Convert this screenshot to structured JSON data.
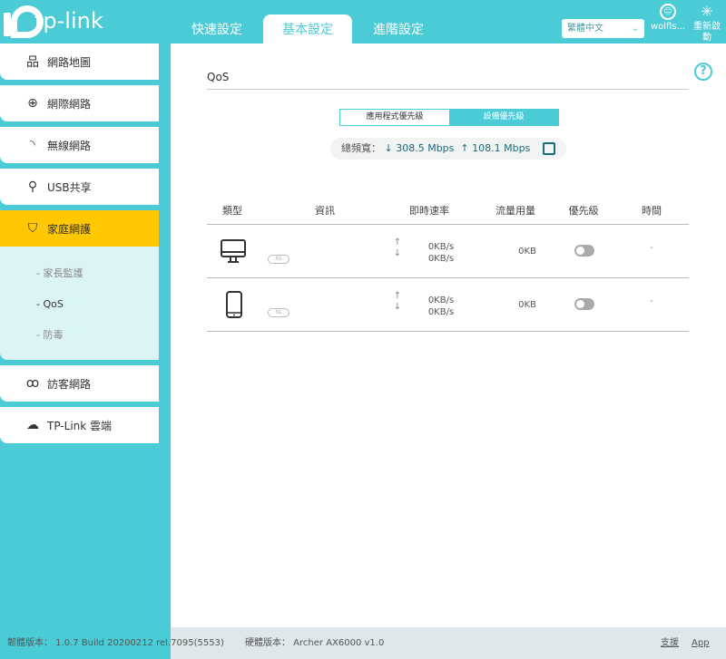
{
  "header": {
    "brand": "tp-link",
    "tabs": [
      "快速設定",
      "基本設定",
      "進階設定"
    ],
    "active_tab": 1,
    "language": "繁體中文",
    "user": "wolfls...",
    "reboot": "重新啟動"
  },
  "sidebar": {
    "items": [
      {
        "label": "網路地圖",
        "icon": "network-map-icon"
      },
      {
        "label": "網際網路",
        "icon": "globe-icon"
      },
      {
        "label": "無線網路",
        "icon": "wireless-icon"
      },
      {
        "label": "USB共享",
        "icon": "usb-icon"
      },
      {
        "label": "家庭網護",
        "icon": "shield-icon"
      },
      {
        "label": "訪客網路",
        "icon": "guests-icon"
      },
      {
        "label": "TP-Link 雲端",
        "icon": "cloud-icon"
      }
    ],
    "subitems": [
      "家長監護",
      "QoS",
      "防毒"
    ],
    "active_sub": "QoS"
  },
  "main": {
    "title": "QoS",
    "segments": [
      "應用程式優先級",
      "設備優先級"
    ],
    "active_segment": 1,
    "bandwidth": {
      "label": "總頻寬：",
      "down": "308.5 Mbps",
      "up": "108.1 Mbps"
    },
    "columns": [
      "類型",
      "資訊",
      "即時速率",
      "流量用量",
      "優先級",
      "時間"
    ],
    "rows": [
      {
        "type": "desktop-icon",
        "band": "5G",
        "up": "0KB/s",
        "down": "0KB/s",
        "traffic": "0KB",
        "priority": false,
        "time": "-"
      },
      {
        "type": "phone-icon",
        "band": "5G",
        "up": "0KB/s",
        "down": "0KB/s",
        "traffic": "0KB",
        "priority": false,
        "time": "-"
      }
    ]
  },
  "footer": {
    "firmware": "韌體版本： 1.0.7 Build 20200212 rel.7095(5553)",
    "hardware": "硬體版本： Archer AX6000 v1.0",
    "support": "支援",
    "app": "App"
  },
  "colors": {
    "accent": "#4acbd6",
    "active_nav": "#ffc800"
  }
}
